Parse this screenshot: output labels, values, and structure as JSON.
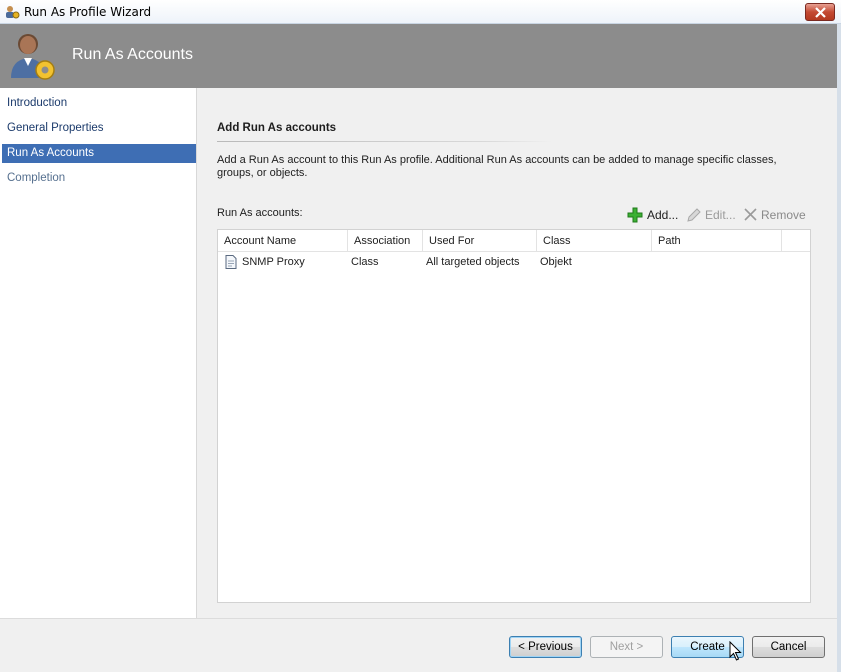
{
  "window": {
    "title": "Run As Profile Wizard",
    "close_icon": "close-icon"
  },
  "banner": {
    "title": "Run As Accounts",
    "icon": "user-gear-icon"
  },
  "nav": {
    "items": [
      {
        "label": "Introduction",
        "state": "normal"
      },
      {
        "label": "General Properties",
        "state": "normal"
      },
      {
        "label": "Run As Accounts",
        "state": "selected"
      },
      {
        "label": "Completion",
        "state": "dim"
      }
    ]
  },
  "main": {
    "heading": "Add Run As accounts",
    "description": "Add a Run As account to this Run As profile.  Additional Run As accounts can be added to manage specific classes, groups, or objects.",
    "accounts_label": "Run As accounts:",
    "toolbar": {
      "add": "Add...",
      "edit": "Edit...",
      "remove": "Remove"
    },
    "table": {
      "columns": [
        "Account Name",
        "Association",
        "Used For",
        "Class",
        "Path"
      ],
      "rows": [
        {
          "account_name": "SNMP Proxy",
          "association": "Class",
          "used_for": "All targeted objects",
          "class": "Objekt",
          "path": ""
        }
      ]
    }
  },
  "footer": {
    "previous": "< Previous",
    "next": "Next >",
    "create": "Create",
    "cancel": "Cancel"
  },
  "colors": {
    "banner": "#8c8c8c",
    "nav_selected": "#3e6eb4",
    "add_icon": "#3cb034"
  }
}
